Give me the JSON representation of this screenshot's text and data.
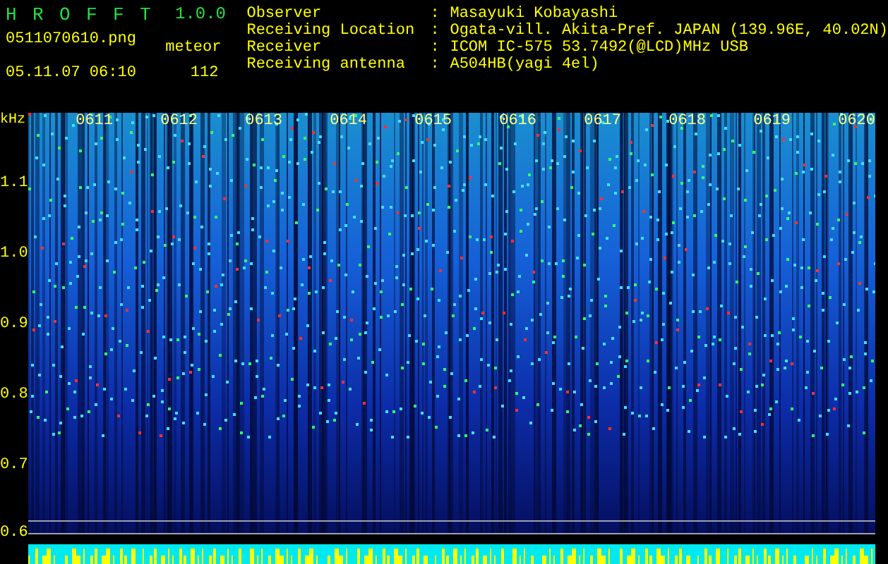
{
  "app": {
    "title_letters": [
      "H",
      "R",
      "O",
      "F",
      "F",
      "T"
    ],
    "version": "1.0.0",
    "filename": "0511070610.png",
    "timestamp": "05.11.07 06:10",
    "meteor_label": "meteor",
    "meteor_count": "112"
  },
  "info": [
    {
      "label": "Observer",
      "separator": ":",
      "value": "Masayuki Kobayashi"
    },
    {
      "label": "Receiving Location",
      "separator": ":",
      "value": "Ogata-vill. Akita-Pref. JAPAN (139.96E, 40.02N)"
    },
    {
      "label": "Receiver",
      "separator": ":",
      "value": "ICOM IC-575 53.7492(@LCD)MHz USB"
    },
    {
      "label": "Receiving antenna",
      "separator": ":",
      "value": "A504HB(yagi 4el)"
    }
  ],
  "plot": {
    "y_unit": "kHz",
    "y_labels": [
      "1.1",
      "1.0",
      "0.9",
      "0.8",
      "0.7",
      "0.6"
    ],
    "time_labels": [
      "0611",
      "0612",
      "0613",
      "0614",
      "0615",
      "0616",
      "0617",
      "0618",
      "0619",
      "0620"
    ]
  }
}
